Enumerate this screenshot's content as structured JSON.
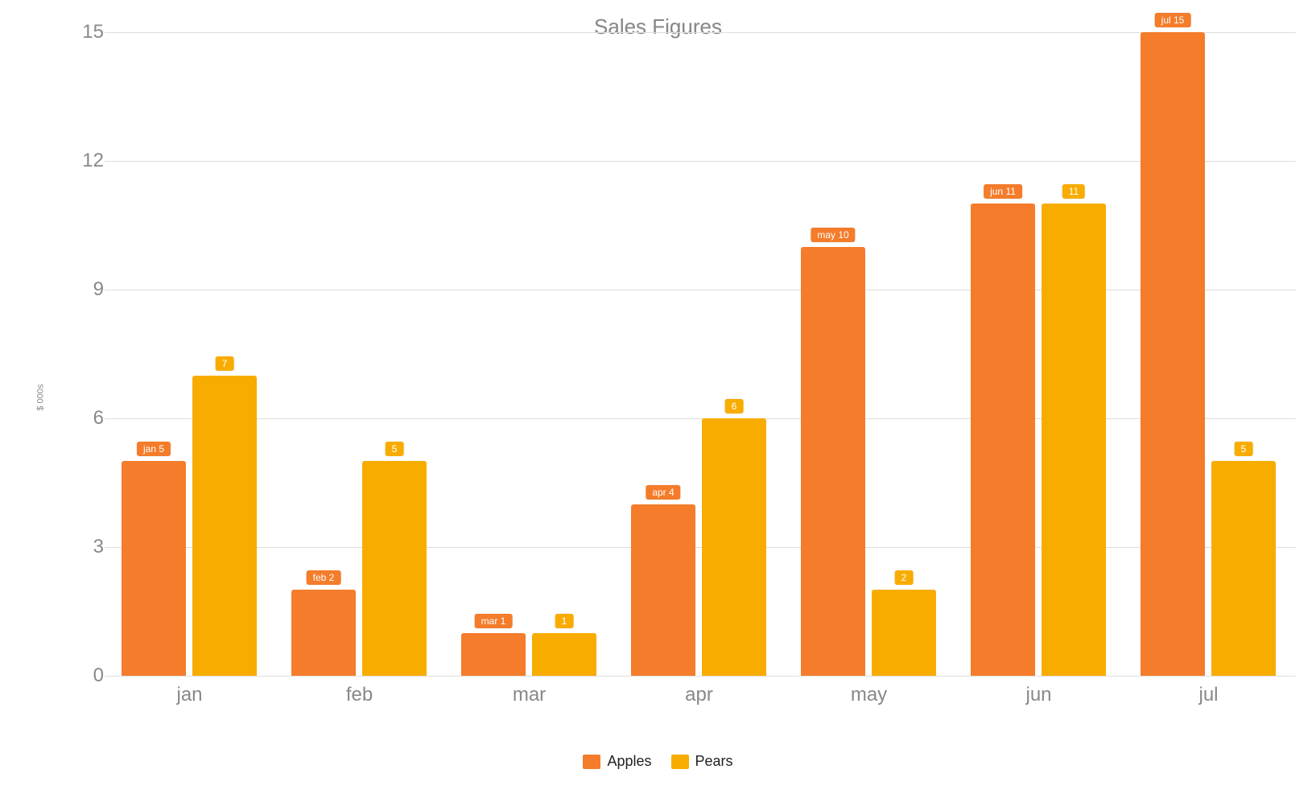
{
  "chart_data": {
    "type": "bar",
    "title": "Sales Figures",
    "ylabel": "$ 000s",
    "ylim": [
      0,
      15
    ],
    "yticks": [
      0,
      3,
      6,
      9,
      12,
      15
    ],
    "categories": [
      "jan",
      "feb",
      "mar",
      "apr",
      "may",
      "jun",
      "jul"
    ],
    "series": [
      {
        "name": "Apples",
        "color": "#f47c2a",
        "values": [
          5,
          2,
          1,
          4,
          10,
          11,
          15
        ],
        "value_labels": [
          "jan 5",
          "feb 2",
          "mar 1",
          "apr 4",
          "may 10",
          "jun 11",
          "jul 15"
        ]
      },
      {
        "name": "Pears",
        "color": "#f8ac00",
        "values": [
          7,
          5,
          1,
          6,
          2,
          11,
          5
        ],
        "value_labels": [
          "7",
          "5",
          "1",
          "6",
          "2",
          "11",
          "5"
        ]
      }
    ],
    "legend_position": "bottom"
  }
}
